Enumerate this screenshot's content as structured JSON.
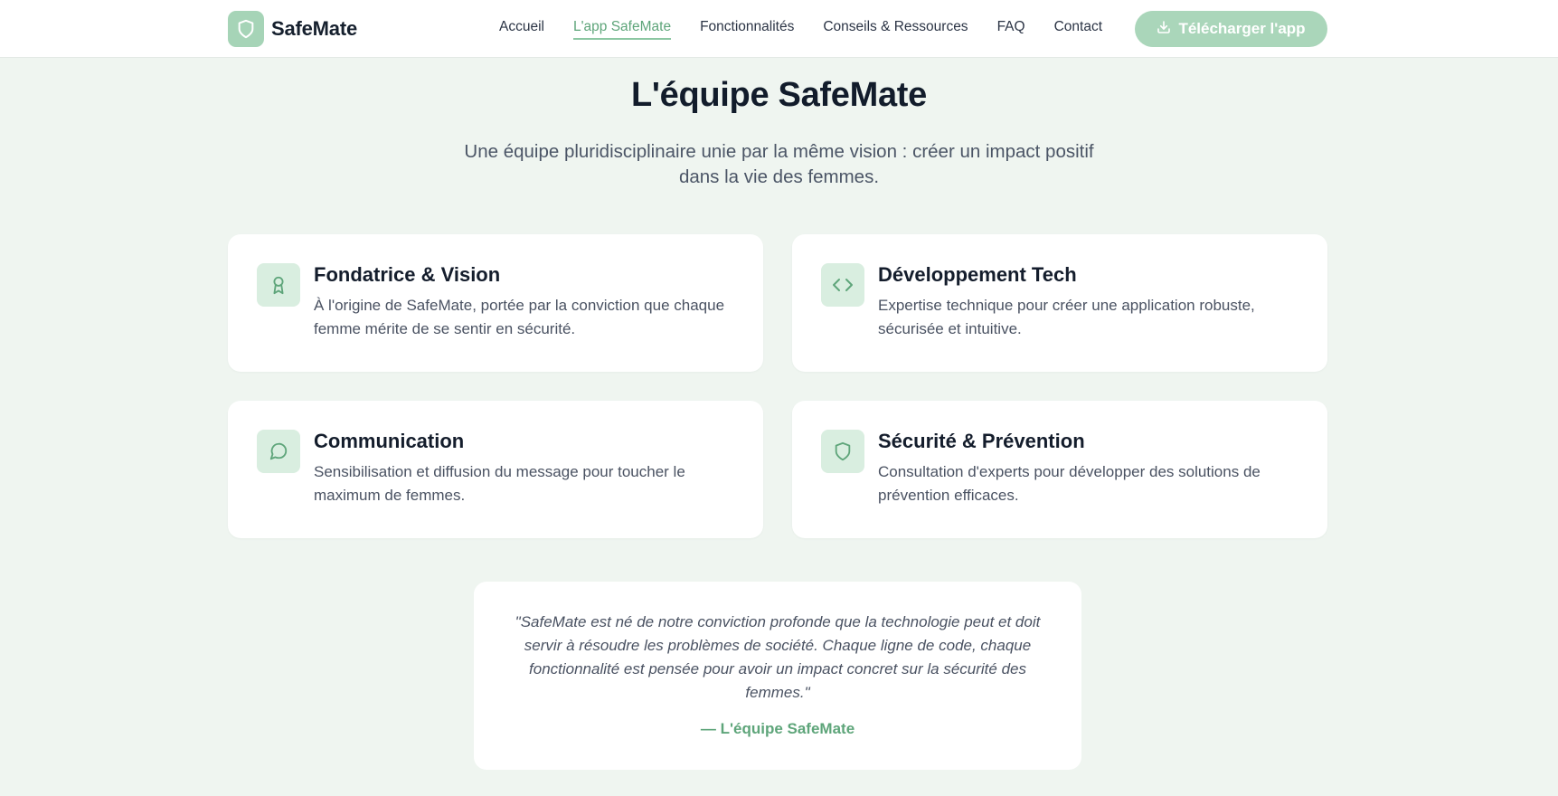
{
  "header": {
    "brand_name": "SafeMate",
    "nav": [
      {
        "label": "Accueil"
      },
      {
        "label": "L'app SafeMate"
      },
      {
        "label": "Fonctionnalités"
      },
      {
        "label": "Conseils & Ressources"
      },
      {
        "label": "FAQ"
      },
      {
        "label": "Contact"
      }
    ],
    "active_nav": "L'app SafeMate",
    "download_label": "Télécharger l'app"
  },
  "team": {
    "title": "L'équipe SafeMate",
    "subtitle": "Une équipe pluridisciplinaire unie par la même vision : créer un impact positif dans la vie des femmes.",
    "cards": [
      {
        "icon": "award-icon",
        "title": "Fondatrice & Vision",
        "description": "À l'origine de SafeMate, portée par la conviction que chaque femme mérite de se sentir en sécurité."
      },
      {
        "icon": "code-icon",
        "title": "Développement Tech",
        "description": "Expertise technique pour créer une application robuste, sécurisée et intuitive."
      },
      {
        "icon": "message-circle-icon",
        "title": "Communication",
        "description": "Sensibilisation et diffusion du message pour toucher le maximum de femmes."
      },
      {
        "icon": "shield-icon",
        "title": "Sécurité & Prévention",
        "description": "Consultation d'experts pour développer des solutions de prévention efficaces."
      }
    ],
    "quote": {
      "text": "\"SafeMate est né de notre conviction profonde que la technologie peut et doit servir à résoudre les problèmes de société. Chaque ligne de code, chaque fonctionnalité est pensée pour avoir un impact concret sur la sécurité des femmes.\"",
      "author": "— L'équipe SafeMate"
    }
  },
  "colors": {
    "accent": "#5ea57a",
    "accent_light": "#a6d4b7",
    "icon_bg": "#d9eee0",
    "page_bg": "#eff5f0"
  }
}
